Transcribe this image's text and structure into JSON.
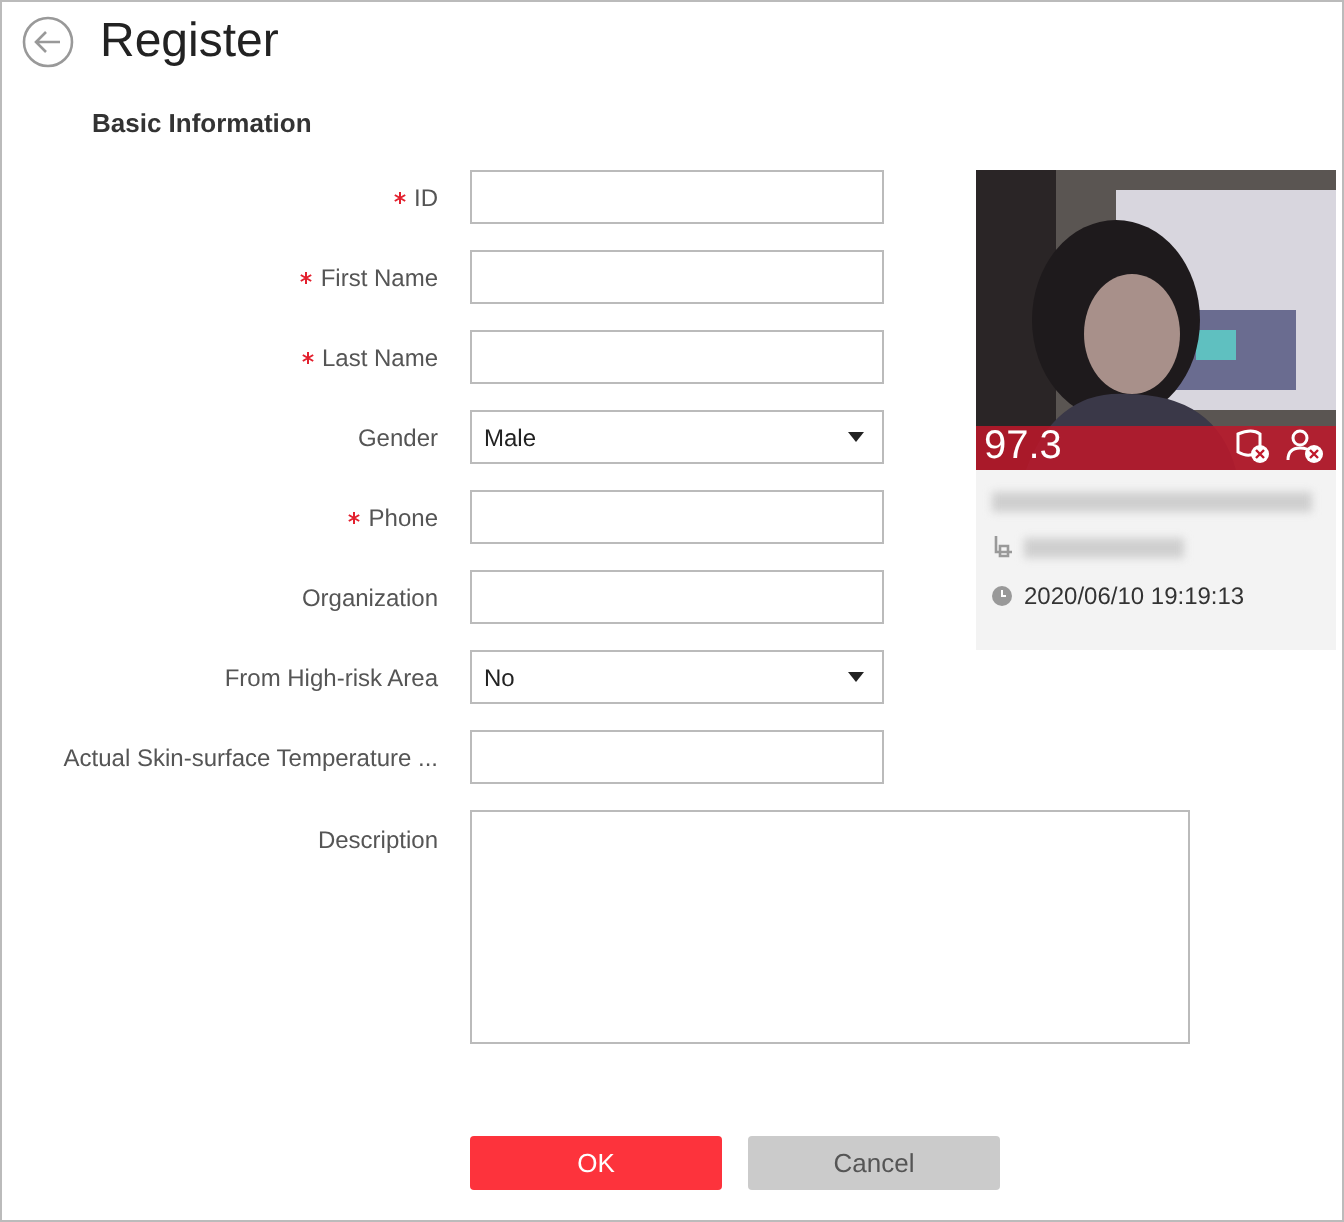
{
  "title": "Register",
  "section": "Basic Information",
  "fields": [
    {
      "kind": "input",
      "label": "ID",
      "required": true
    },
    {
      "kind": "input",
      "label": "First Name",
      "required": true
    },
    {
      "kind": "input",
      "label": "Last Name",
      "required": true
    },
    {
      "kind": "select",
      "label": "Gender",
      "required": false,
      "value": "Male"
    },
    {
      "kind": "input",
      "label": "Phone",
      "required": true
    },
    {
      "kind": "input",
      "label": "Organization",
      "required": false
    },
    {
      "kind": "select",
      "label": "From High-risk Area",
      "required": false,
      "value": "No"
    },
    {
      "kind": "input",
      "label": "Actual Skin-surface Temperature ...",
      "required": false
    },
    {
      "kind": "textarea",
      "label": "Description",
      "required": false
    }
  ],
  "capture": {
    "temperature": "97.3",
    "time": "2020/06/10 19:19:13"
  },
  "buttons": [
    {
      "kind": "primary",
      "label": "OK"
    },
    {
      "kind": "secondary",
      "label": "Cancel"
    }
  ]
}
